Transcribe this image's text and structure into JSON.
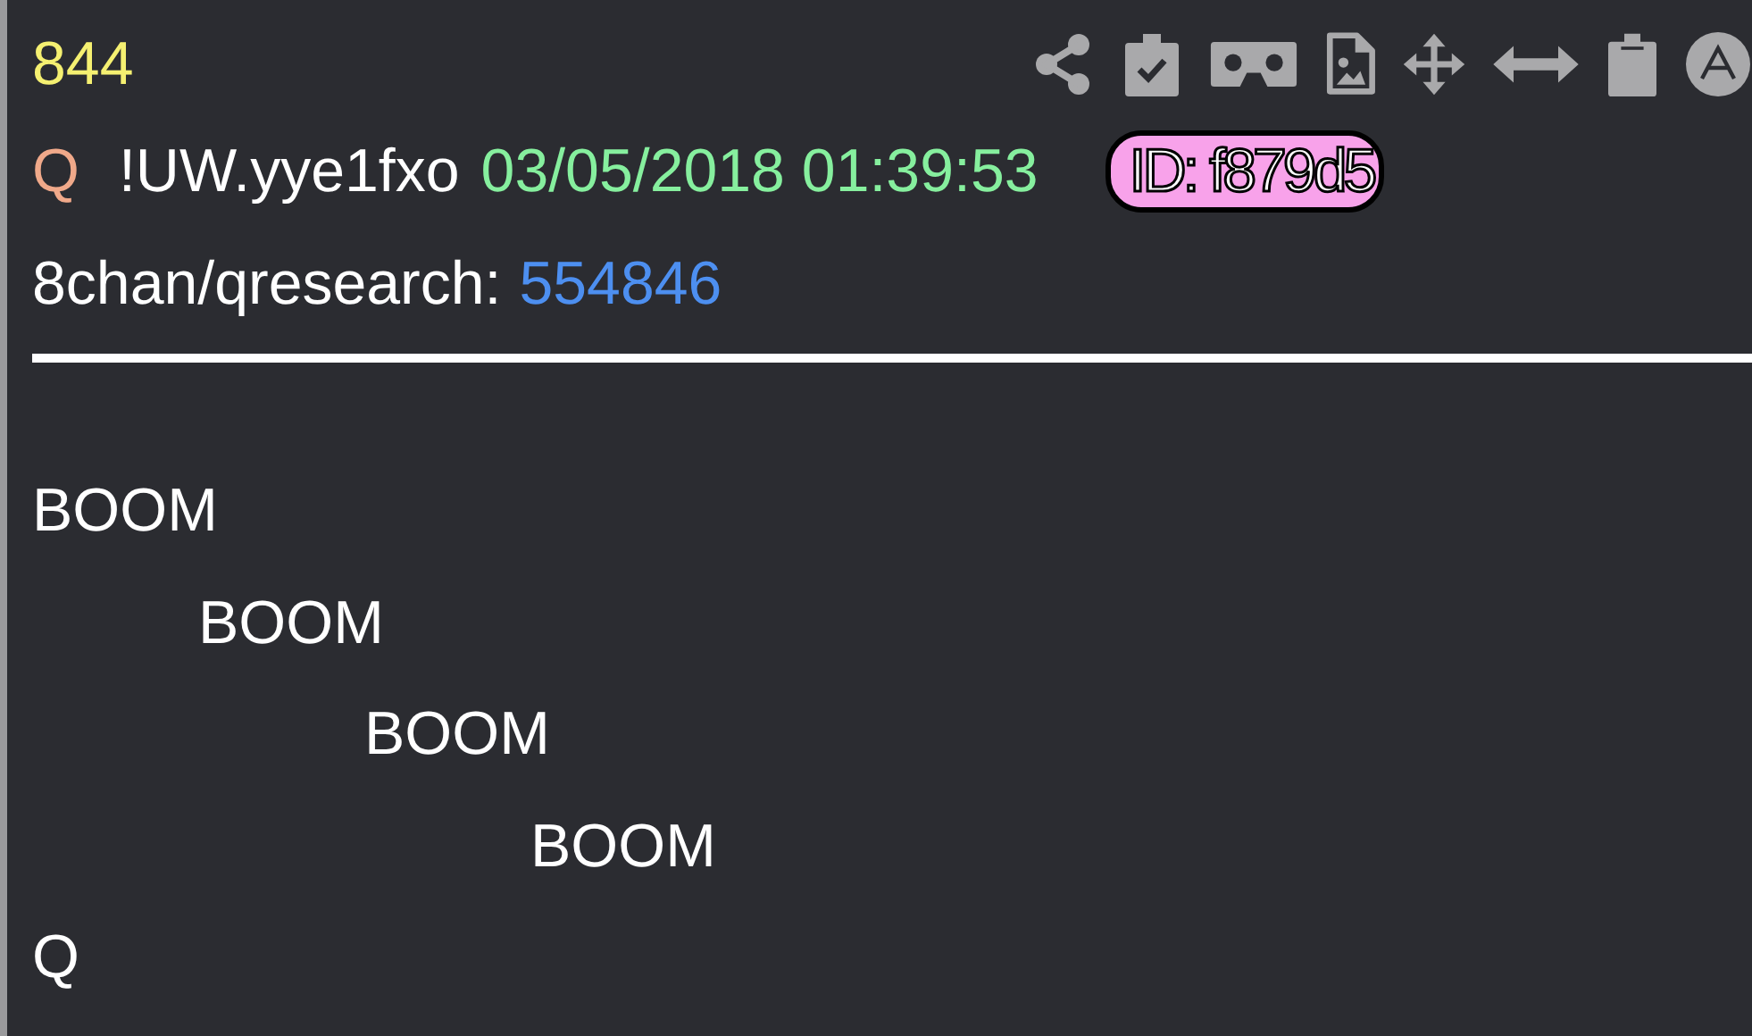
{
  "post_number": "844",
  "toolbar": [
    {
      "kind": "share"
    },
    {
      "kind": "clipboard-check"
    },
    {
      "kind": "viewer"
    },
    {
      "kind": "image-file"
    },
    {
      "kind": "move"
    },
    {
      "kind": "resize"
    },
    {
      "kind": "clipboard"
    },
    {
      "kind": "circle-a"
    }
  ],
  "author": {
    "name": "Q",
    "tripcode": "!UW.yye1fxo",
    "timestamp": "03/05/2018 01:39:53",
    "id_badge": "ID: f879d5"
  },
  "source": {
    "board": "8chan/qresearch:",
    "post_link": "554846"
  },
  "body": [
    "BOOM",
    "\tBOOM",
    "\t\tBOOM",
    "\t\t\tBOOM",
    "Q"
  ]
}
